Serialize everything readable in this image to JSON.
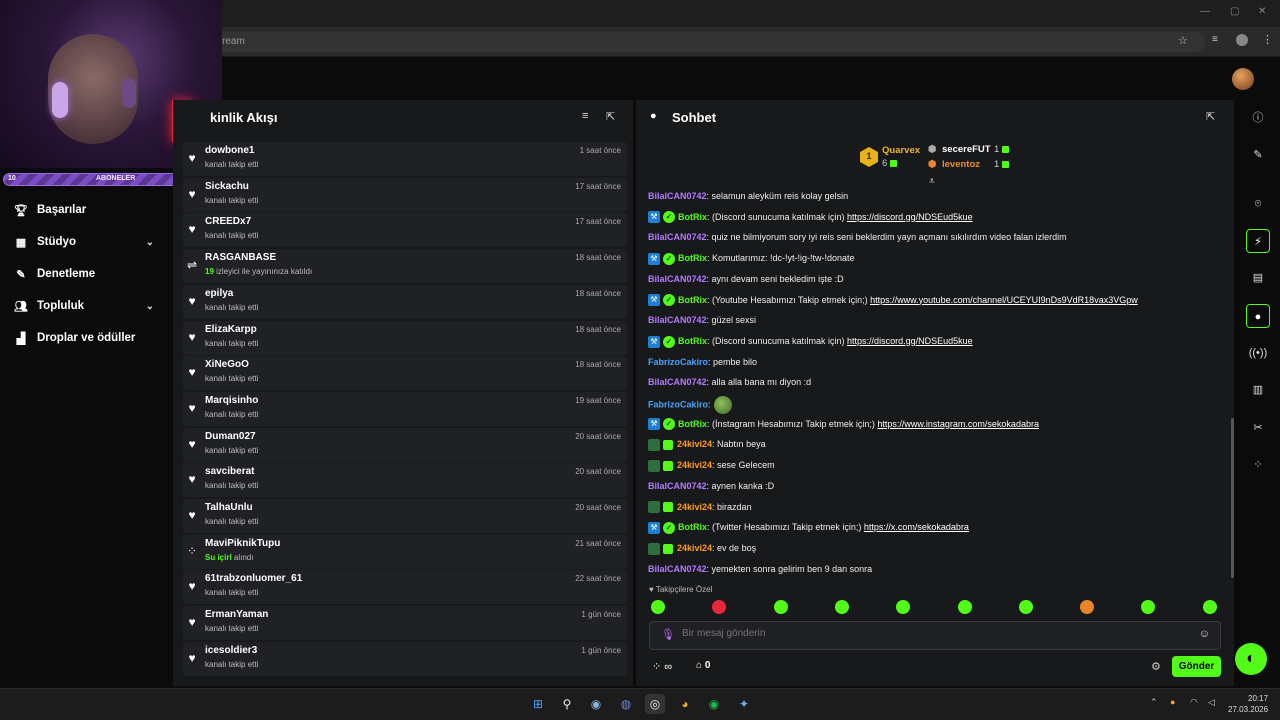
{
  "browser": {
    "url_fragment": "ream"
  },
  "subbar": {
    "left_count": "10",
    "label": "ABONELER",
    "right_count": "29"
  },
  "nav": [
    {
      "label": "Başarılar",
      "icon": "trophy-icon"
    },
    {
      "label": "Stüdyo",
      "icon": "studio-icon"
    },
    {
      "label": "Denetleme",
      "icon": "wrench-icon"
    },
    {
      "label": "Topluluk",
      "icon": "community-icon"
    },
    {
      "label": "Droplar ve ödüller",
      "icon": "drops-icon"
    }
  ],
  "feed": {
    "title": "kinlik Akışı",
    "events": [
      {
        "name": "dowbone1",
        "sub": "kanalı takip etti",
        "time": "1 saat önce",
        "icon": "heart-icon"
      },
      {
        "name": "Sickachu",
        "sub": "kanalı takip etti",
        "time": "17 saat önce",
        "icon": "heart-icon"
      },
      {
        "name": "CREEDx7",
        "sub": "kanalı takip etti",
        "time": "17 saat önce",
        "icon": "heart-icon"
      },
      {
        "name": "RASGANBASE",
        "sub_count": "19",
        "sub": " izleyici ile yayınınıza katıldı",
        "time": "18 saat önce",
        "icon": "raid-icon"
      },
      {
        "name": "epilya",
        "sub": "kanalı takip etti",
        "time": "18 saat önce",
        "icon": "heart-icon"
      },
      {
        "name": "ElizaKarpp",
        "sub": "kanalı takip etti",
        "time": "18 saat önce",
        "icon": "heart-icon"
      },
      {
        "name": "XiNeGoO",
        "sub": "kanalı takip etti",
        "time": "18 saat önce",
        "icon": "heart-icon"
      },
      {
        "name": "Marqisinho",
        "sub": "kanalı takip etti",
        "time": "19 saat önce",
        "icon": "heart-icon"
      },
      {
        "name": "Duman027",
        "sub": "kanalı takip etti",
        "time": "20 saat önce",
        "icon": "heart-icon"
      },
      {
        "name": "savciberat",
        "sub": "kanalı takip etti",
        "time": "20 saat önce",
        "icon": "heart-icon"
      },
      {
        "name": "TalhaUnlu",
        "sub": "kanalı takip etti",
        "time": "20 saat önce",
        "icon": "heart-icon"
      },
      {
        "name": "MaviPiknikTupu",
        "sub_count": "Su içirl",
        "sub": " alındı",
        "time": "21 saat önce",
        "icon": "points-icon"
      },
      {
        "name": "61trabzonluomer_61",
        "sub": "kanalı takip etti",
        "time": "22 saat önce",
        "icon": "heart-icon"
      },
      {
        "name": "ErmanYaman",
        "sub": "kanalı takip etti",
        "time": "1 gün önce",
        "icon": "heart-icon"
      },
      {
        "name": "icesoldier3",
        "sub": "kanalı takip etti",
        "time": "1 gün önce",
        "icon": "heart-icon"
      }
    ]
  },
  "chat": {
    "title": "Sohbet",
    "podium": {
      "first": {
        "rank": "1",
        "name": "Quarvex",
        "count": "6"
      },
      "second": {
        "name": "secereFUT",
        "count": "1"
      },
      "third": {
        "name": "leventoz",
        "count": "1"
      }
    },
    "messages": [
      {
        "user": "BilalCAN0742",
        "color": "#b57bff",
        "text": ": selamun aleyküm reis kolay gelsin"
      },
      {
        "user": "BotRix",
        "color": "#53fc18",
        "bot": true,
        "text": ": (Discord sunucuma katılmak için) ",
        "link": "https://discord.gg/NDSEud5kue"
      },
      {
        "user": "BilalCAN0742",
        "color": "#b57bff",
        "text": ": quiz ne bilmiyorum sory iyi reis seni beklerdim yayn açmanı sıkılırdım video falan izlerdim"
      },
      {
        "user": "BotRix",
        "color": "#53fc18",
        "bot": true,
        "text": ": Komutlarımız: !dc-!yt-!ig-!tw-!donate"
      },
      {
        "user": "BilalCAN0742",
        "color": "#b57bff",
        "text": ": aynı devam seni bekledim işte :D"
      },
      {
        "user": "BotRix",
        "color": "#53fc18",
        "bot": true,
        "text": ": (Youtube Hesabımızı Takip etmek için;) ",
        "link": "https://www.youtube.com/channel/UCEYUI9nDs9VdR18vax3VGpw"
      },
      {
        "user": "BilalCAN0742",
        "color": "#b57bff",
        "text": ": güzel sexsi"
      },
      {
        "user": "BotRix",
        "color": "#53fc18",
        "bot": true,
        "text": ": (Discord sunucuma katılmak için) ",
        "link": "https://discord.gg/NDSEud5kue"
      },
      {
        "user": "FabrizoCakiro",
        "color": "#4aa3ff",
        "text": ": pembe bilo"
      },
      {
        "user": "BilalCAN0742",
        "color": "#b57bff",
        "text": ": alla alla bana mı diyon :d"
      },
      {
        "user": "FabrizoCakiro",
        "color": "#4aa3ff",
        "text": ":",
        "emote": true
      },
      {
        "user": "BotRix",
        "color": "#53fc18",
        "bot": true,
        "text": ": (İnstagram Hesabımızı Takip etmek için;) ",
        "link": "https://www.instagram.com/sekokadabra"
      },
      {
        "user": "24kivi24",
        "color": "#ff9b1a",
        "sub": true,
        "text": ": Nabtın beya"
      },
      {
        "user": "24kivi24",
        "color": "#ff9b1a",
        "sub": true,
        "text": ": sese Gelecem"
      },
      {
        "user": "BilalCAN0742",
        "color": "#b57bff",
        "text": ": aynen kanka :D"
      },
      {
        "user": "24kivi24",
        "color": "#ff9b1a",
        "sub": true,
        "text": ": birazdan"
      },
      {
        "user": "BotRix",
        "color": "#53fc18",
        "bot": true,
        "text": ": (Twitter Hesabımızı Takip etmek için;) ",
        "link": "https://x.com/sekokadabra"
      },
      {
        "user": "24kivi24",
        "color": "#ff9b1a",
        "sub": true,
        "text": ": ev de boş"
      },
      {
        "user": "BilalCAN0742",
        "color": "#b57bff",
        "text": ": yemekten sonra gelirim ben 9 dan sonra"
      }
    ],
    "emotes_label": "Takipçilere Özel",
    "input_placeholder": "Bir mesaj gönderin",
    "points_value": "∞",
    "store_count": "0",
    "send_label": "Gönder"
  },
  "clock": {
    "time": "20:17",
    "date": "27.03.2026"
  },
  "colors": {
    "accent": "#53fc18",
    "panel": "#18191b",
    "bg": "#0b0b0c"
  }
}
